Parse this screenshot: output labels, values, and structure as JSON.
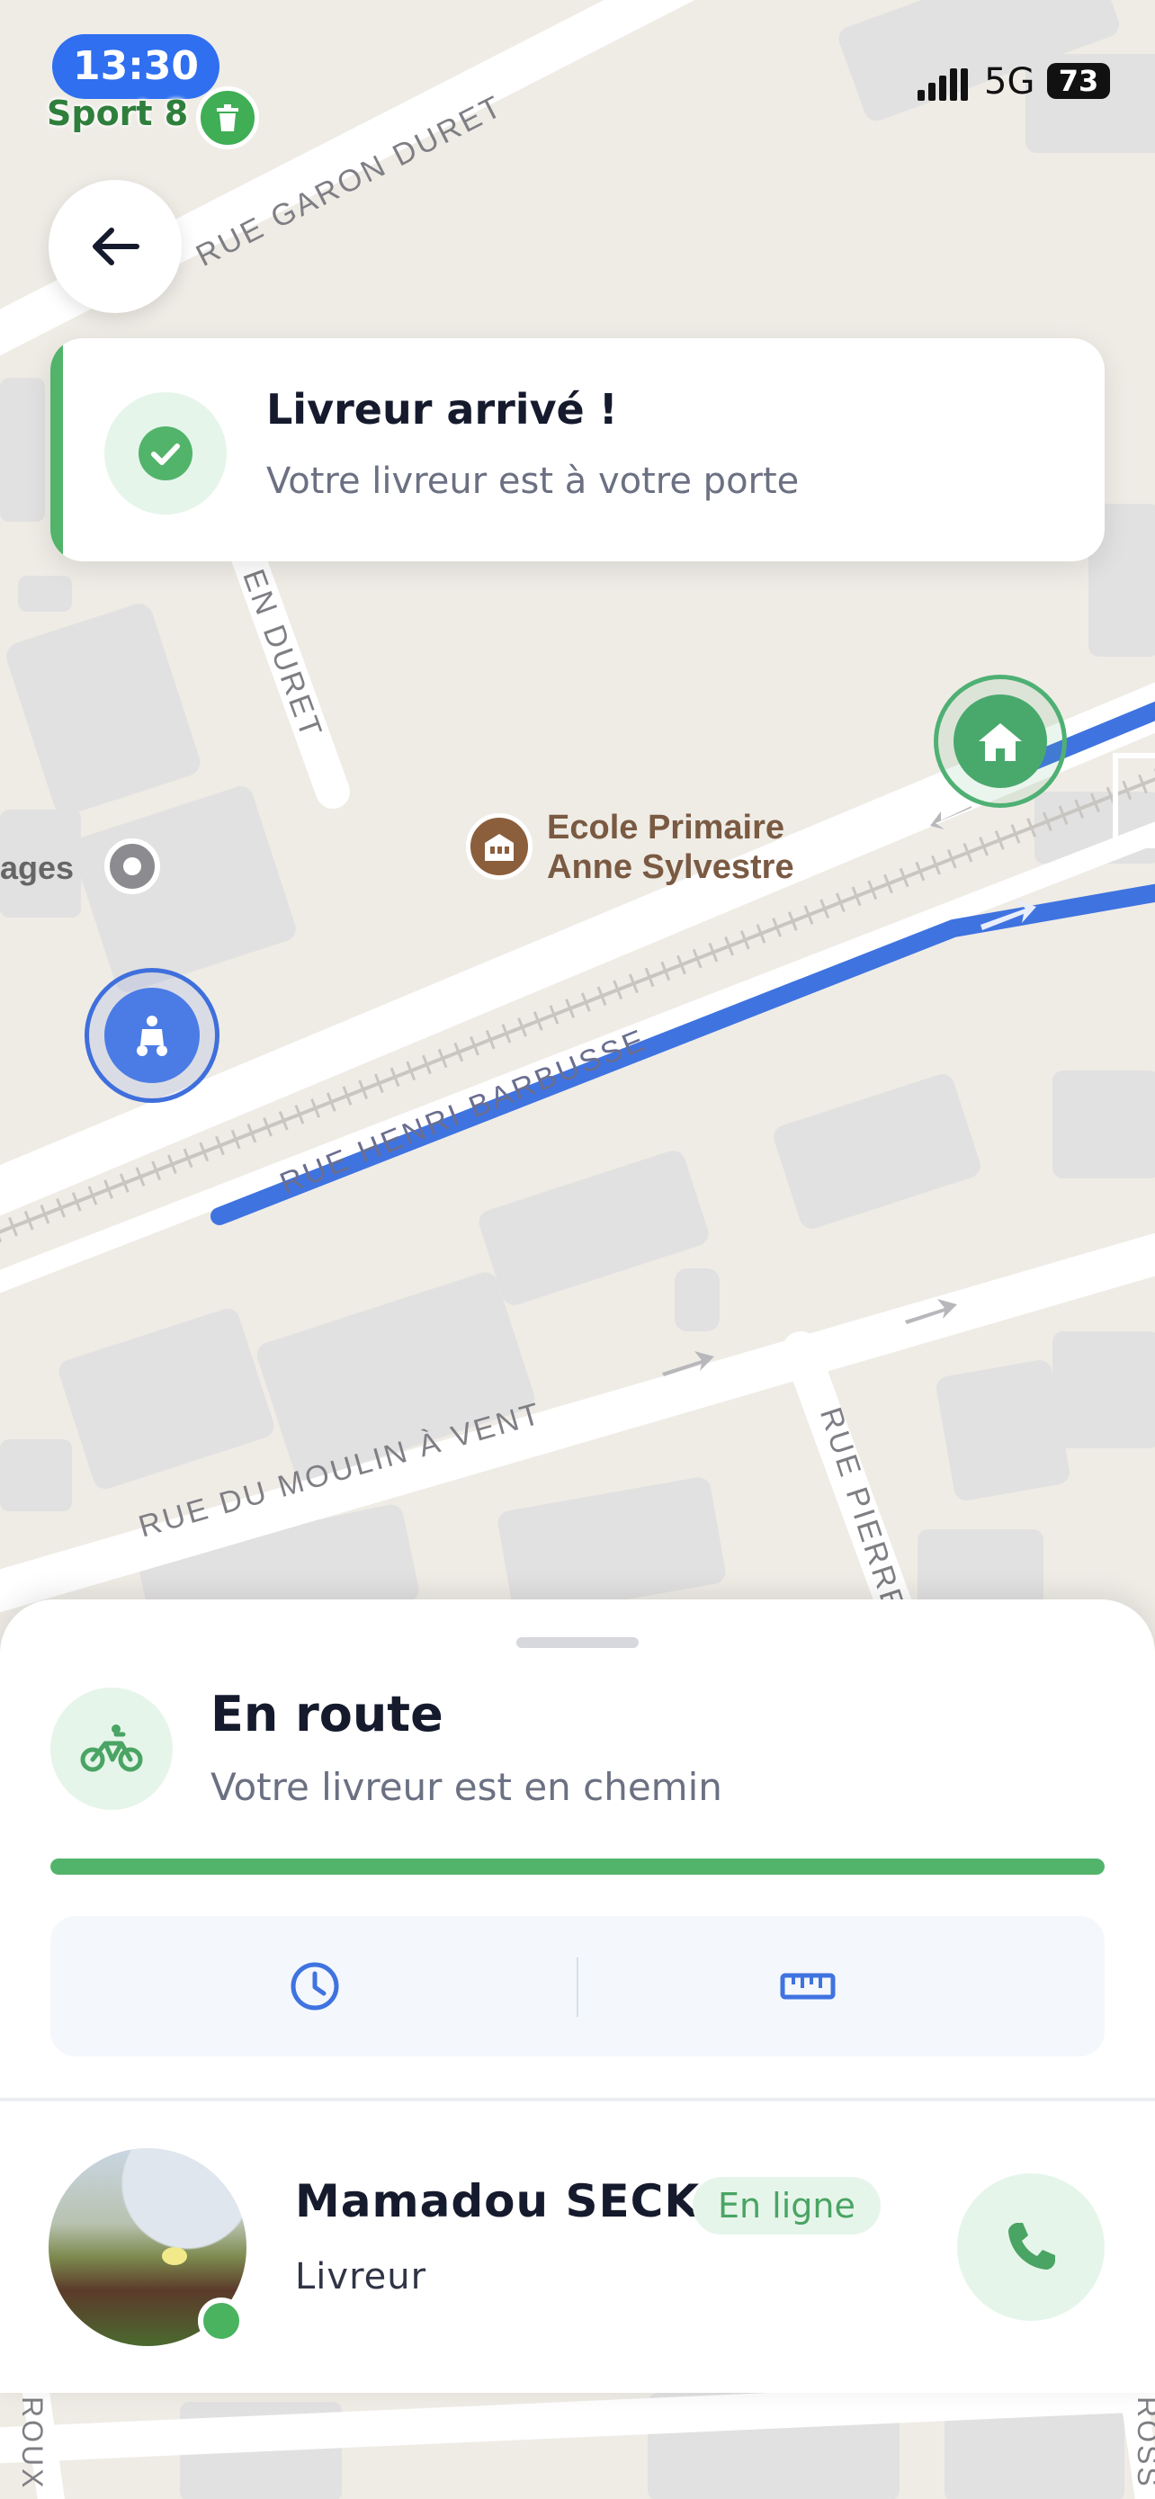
{
  "status_bar": {
    "time": "13:30",
    "network": "5G",
    "battery": "73",
    "app_badge_label": "Sport 8"
  },
  "notification": {
    "title": "Livreur arrivé !",
    "subtitle": "Votre livreur est à votre porte"
  },
  "map": {
    "street_labels": {
      "garon_duret": "RUE GARON DURET",
      "en_duret": "EN DURET",
      "henri_barbusse": "RUE HENRI BARBUSSE",
      "moulin_a_vent": "RUE DU MOULIN À VENT",
      "pierre": "RUE PIERRE",
      "ages": "ages",
      "bottom_left": "ROUX",
      "bottom_right": "ROSS"
    },
    "poi": {
      "name_line1": "Ecole Primaire",
      "name_line2": "Anne Sylvestre"
    },
    "colors": {
      "route": "#3f73e0",
      "home_marker": "#49a96c",
      "rider_marker": "#4b7ce6"
    }
  },
  "delivery": {
    "status_title": "En route",
    "status_subtitle": "Votre livreur est en chemin",
    "progress": 1.0,
    "info_icons": [
      "clock-icon",
      "ruler-icon"
    ]
  },
  "courier": {
    "name": "Mamadou SECK",
    "status_badge": "En ligne",
    "role": "Livreur"
  },
  "colors": {
    "accent_green": "#52b46a",
    "accent_blue": "#3f73e0",
    "text_primary": "#151a2d",
    "text_secondary": "#6b7082"
  }
}
